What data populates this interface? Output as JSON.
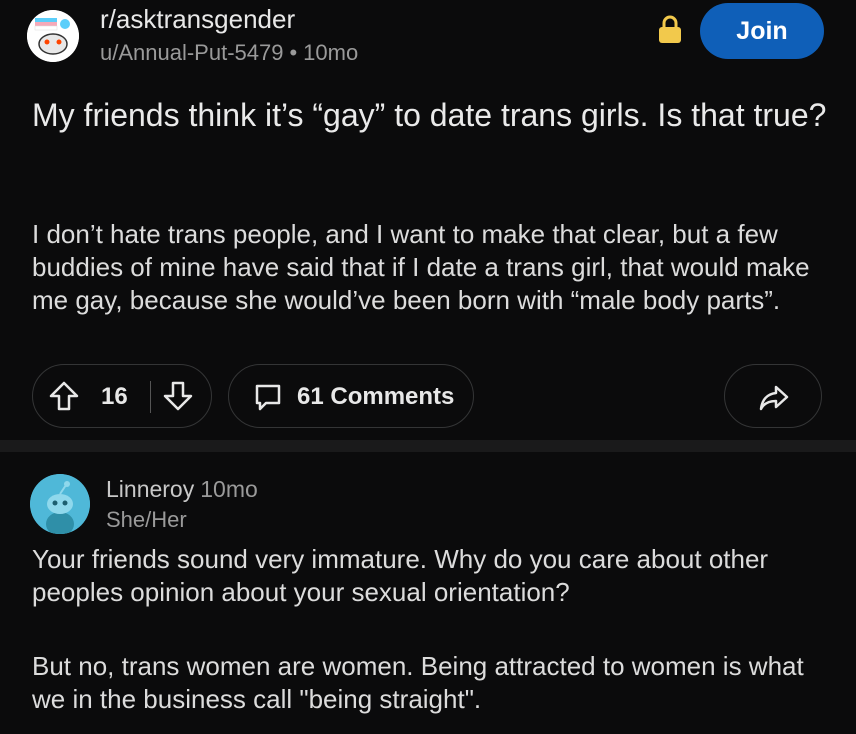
{
  "post": {
    "subreddit": "r/asktransgender",
    "author": "u/Annual-Put-5479",
    "separator": "•",
    "age": "10mo",
    "join_label": "Join",
    "title": "My friends think it’s “gay” to date trans girls. Is that true?",
    "body": "I don’t hate trans people, and I want to make that clear, but a few buddies of mine have said that if I date a trans girl, that would make me gay, because she would’ve been born with “male body parts”.",
    "score": "16",
    "comments_label": "61 Comments"
  },
  "comment": {
    "username": "Linneroy",
    "age": "10mo",
    "flair": "She/Her",
    "paragraphs": [
      "Your friends sound very immature. Why do you care about other peoples opinion about your sexual orientation?",
      "But no, trans women are women. Being attracted to women is what we in the business call \"being straight\"."
    ]
  },
  "colors": {
    "background": "#0b0b0c",
    "join_button": "#0f5fb8",
    "lock": "#f2c94c",
    "comment_avatar": "#4fb8d8"
  },
  "icons": [
    "subreddit-avatar-icon",
    "lock-icon",
    "upvote-icon",
    "downvote-icon",
    "comment-bubble-icon",
    "share-icon",
    "user-avatar-icon"
  ]
}
